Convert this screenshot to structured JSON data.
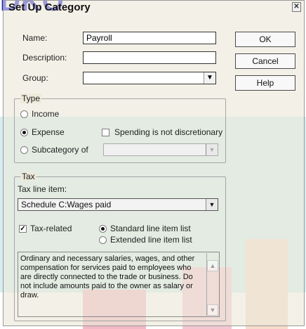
{
  "dialog": {
    "title": "Set Up Category",
    "close_icon": "close-icon"
  },
  "form": {
    "name_label": "Name:",
    "name_value": "Payroll",
    "description_label": "Description:",
    "description_value": "",
    "group_label": "Group:",
    "group_value": ""
  },
  "buttons": {
    "ok": "OK",
    "cancel": "Cancel",
    "help": "Help"
  },
  "type_section": {
    "title": "Type",
    "income": "Income",
    "expense": "Expense",
    "spending_not_discretionary": "Spending is not discretionary",
    "subcategory_of": "Subcategory of",
    "selected": "Expense"
  },
  "tax_section": {
    "title": "Tax",
    "tax_line_label": "Tax line item:",
    "tax_line_value": "Schedule C:Wages paid",
    "tax_related": "Tax-related",
    "tax_related_checked": true,
    "standard_list": "Standard line item list",
    "extended_list": "Extended line item list",
    "selected_list": "Standard line item list",
    "description": "Ordinary and necessary salaries, wages, and other compensation for services paid to employees who are directly connected to the trade or business.  Do not include amounts paid to the owner as salary or draw."
  }
}
